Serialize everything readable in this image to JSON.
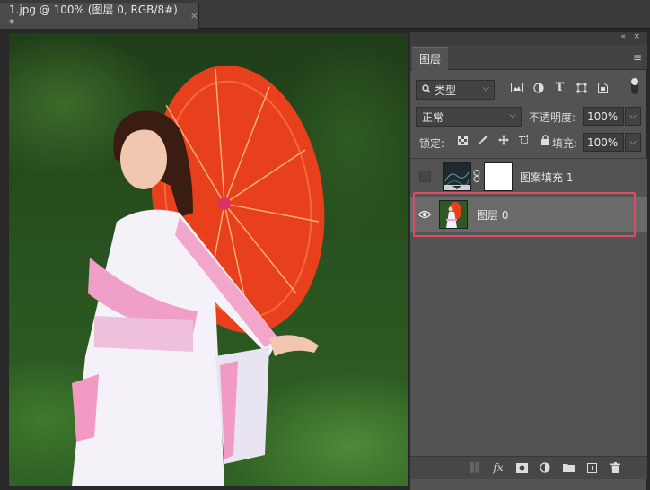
{
  "document_tab": {
    "title": "1.jpg @ 100% (图层 0, RGB/8#) *",
    "close": "×"
  },
  "panel": {
    "tab_label": "图层",
    "collapse": "«",
    "close": "×",
    "menu": "≡"
  },
  "filter": {
    "kind_label": "类型",
    "icons": [
      "image-filter-icon",
      "adjustment-filter-icon",
      "type-filter-icon",
      "shape-filter-icon",
      "smart-object-filter-icon"
    ]
  },
  "blend": {
    "mode": "正常",
    "opacity_label": "不透明度:",
    "opacity_value": "100%"
  },
  "lock": {
    "label": "锁定:",
    "fill_label": "填充:",
    "fill_value": "100%"
  },
  "layers": [
    {
      "name": "图案填充 1",
      "visible": false,
      "selected": false,
      "has_mask": true
    },
    {
      "name": "图层 0",
      "visible": true,
      "selected": true,
      "has_mask": false
    }
  ],
  "colors": {
    "selection_outline": "#e04c64",
    "panel_bg": "#535353",
    "selected_layer_bg": "#6a6a6a"
  }
}
